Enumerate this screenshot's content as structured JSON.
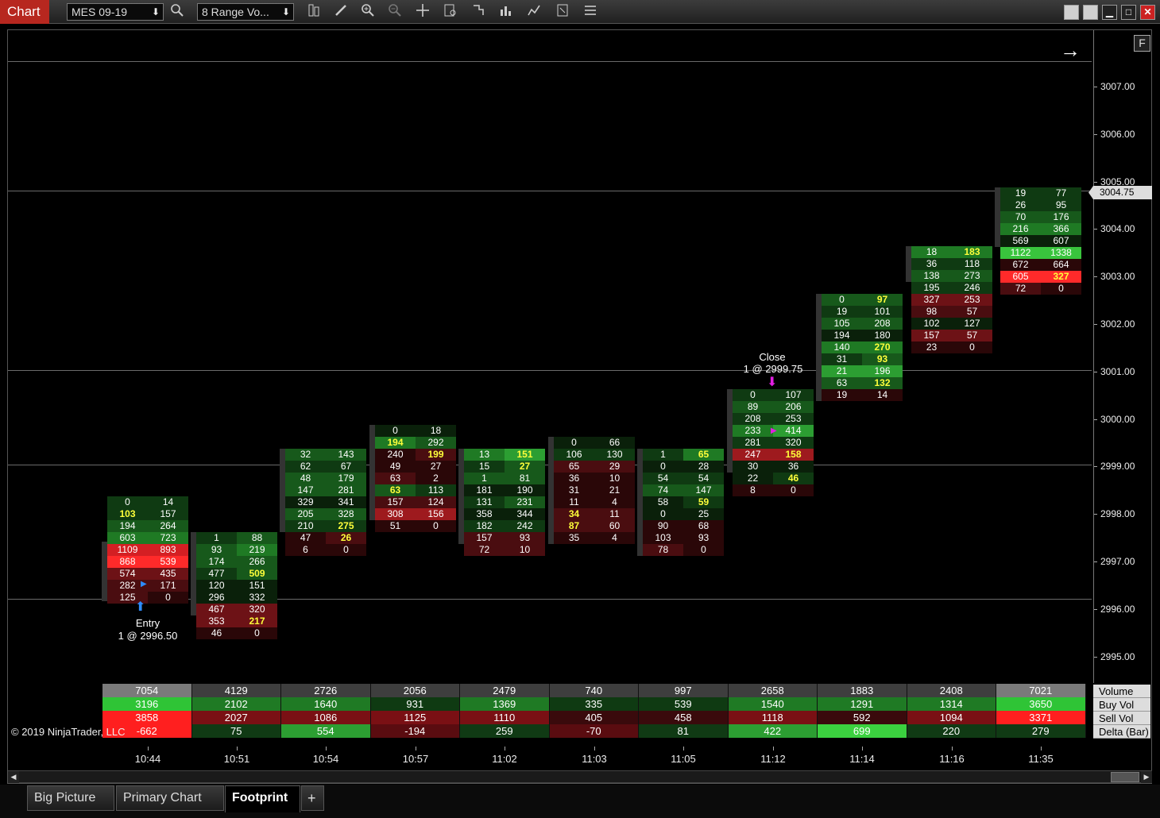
{
  "toolbar": {
    "title": "Chart",
    "instrument": "MES 09-19",
    "bar_type": "8 Range Vo..."
  },
  "window_buttons": [
    "▀",
    "▀",
    "▁",
    "□",
    "✕"
  ],
  "price_axis": {
    "labels": [
      "3007.00",
      "3006.00",
      "3005.00",
      "3004.00",
      "3003.00",
      "3002.00",
      "3001.00",
      "3000.00",
      "2999.00",
      "2998.00",
      "2997.00",
      "2996.00",
      "2995.00"
    ],
    "current_price": "3004.75",
    "f_button": "F"
  },
  "bars": [
    {
      "rows": [
        [
          "0",
          "14",
          "g2",
          "g2"
        ],
        [
          "103",
          "157",
          "g2",
          "g2"
        ],
        [
          "194",
          "264",
          "g3",
          "g3"
        ],
        [
          "603",
          "723",
          "g4",
          "g4"
        ],
        [
          "1109",
          "893",
          "r5",
          "r5"
        ],
        [
          "868",
          "539",
          "r6",
          "r6"
        ],
        [
          "574",
          "435",
          "r3",
          "r3"
        ],
        [
          "282",
          "171",
          "r2",
          "r2"
        ],
        [
          "125",
          "0",
          "r2",
          "r1"
        ]
      ],
      "hl": [
        [
          1,
          0
        ]
      ]
    },
    {
      "rows": [
        [
          "1",
          "88",
          "g2",
          "g3"
        ],
        [
          "93",
          "219",
          "g3",
          "g4"
        ],
        [
          "174",
          "266",
          "g3",
          "g3"
        ],
        [
          "477",
          "509",
          "g2",
          "g3"
        ],
        [
          "120",
          "151",
          "g1",
          "g1"
        ],
        [
          "296",
          "332",
          "g1",
          "g1"
        ],
        [
          "467",
          "320",
          "r3",
          "r3"
        ],
        [
          "353",
          "217",
          "r3",
          "r3"
        ],
        [
          "46",
          "0",
          "r1",
          "r1"
        ]
      ],
      "hl": [
        [
          3,
          1
        ],
        [
          7,
          1
        ]
      ]
    },
    {
      "rows": [
        [
          "32",
          "143",
          "g3",
          "g3"
        ],
        [
          "62",
          "67",
          "g2",
          "g2"
        ],
        [
          "48",
          "179",
          "g3",
          "g3"
        ],
        [
          "147",
          "281",
          "g3",
          "g3"
        ],
        [
          "329",
          "341",
          "g1",
          "g1"
        ],
        [
          "205",
          "328",
          "g3",
          "g3"
        ],
        [
          "210",
          "275",
          "g2",
          "g2"
        ],
        [
          "47",
          "26",
          "r1",
          "r2"
        ],
        [
          "6",
          "0",
          "r1",
          "r1"
        ]
      ],
      "hl": [
        [
          6,
          1
        ],
        [
          7,
          1
        ]
      ]
    },
    {
      "rows": [
        [
          "0",
          "18",
          "g1",
          "g1"
        ],
        [
          "194",
          "292",
          "g4",
          "g3"
        ],
        [
          "240",
          "199",
          "r1",
          "r2"
        ],
        [
          "49",
          "27",
          "r1",
          "r1"
        ],
        [
          "63",
          "2",
          "r2",
          "r1"
        ],
        [
          "63",
          "113",
          "g3",
          "g2"
        ],
        [
          "157",
          "124",
          "r2",
          "r2"
        ],
        [
          "308",
          "156",
          "r4",
          "r4"
        ],
        [
          "51",
          "0",
          "r1",
          "r1"
        ]
      ],
      "hl": [
        [
          1,
          0
        ],
        [
          2,
          1
        ],
        [
          5,
          0
        ]
      ]
    },
    {
      "rows": [
        [
          "13",
          "151",
          "g4",
          "g5"
        ],
        [
          "15",
          "27",
          "g2",
          "g3"
        ],
        [
          "1",
          "81",
          "g3",
          "g3"
        ],
        [
          "181",
          "190",
          "g1",
          "g1"
        ],
        [
          "131",
          "231",
          "g2",
          "g3"
        ],
        [
          "358",
          "344",
          "g1",
          "g1"
        ],
        [
          "182",
          "242",
          "g2",
          "g2"
        ],
        [
          "157",
          "93",
          "r2",
          "r2"
        ],
        [
          "72",
          "10",
          "r2",
          "r2"
        ]
      ],
      "hl": [
        [
          0,
          1
        ],
        [
          1,
          1
        ]
      ]
    },
    {
      "rows": [
        [
          "0",
          "66",
          "g1",
          "g1"
        ],
        [
          "106",
          "130",
          "g2",
          "g2"
        ],
        [
          "65",
          "29",
          "r2",
          "r2"
        ],
        [
          "36",
          "10",
          "r1",
          "r1"
        ],
        [
          "31",
          "21",
          "r1",
          "r1"
        ],
        [
          "11",
          "4",
          "r1",
          "r1"
        ],
        [
          "34",
          "11",
          "r2",
          "r2"
        ],
        [
          "87",
          "60",
          "r2",
          "r2"
        ],
        [
          "35",
          "4",
          "r1",
          "r1"
        ]
      ],
      "hl": [
        [
          6,
          0
        ],
        [
          7,
          0
        ]
      ]
    },
    {
      "rows": [
        [
          "1",
          "65",
          "g2",
          "g4"
        ],
        [
          "0",
          "28",
          "g1",
          "g1"
        ],
        [
          "54",
          "54",
          "g2",
          "g2"
        ],
        [
          "74",
          "147",
          "g3",
          "g3"
        ],
        [
          "58",
          "59",
          "g1",
          "g2"
        ],
        [
          "0",
          "25",
          "g1",
          "g1"
        ],
        [
          "90",
          "68",
          "r1",
          "r1"
        ],
        [
          "103",
          "93",
          "r1",
          "r1"
        ],
        [
          "78",
          "0",
          "r2",
          "r1"
        ]
      ],
      "hl": [
        [
          0,
          1
        ],
        [
          4,
          1
        ]
      ]
    },
    {
      "rows": [
        [
          "0",
          "107",
          "g2",
          "g2"
        ],
        [
          "89",
          "206",
          "g3",
          "g3"
        ],
        [
          "208",
          "253",
          "g2",
          "g2"
        ],
        [
          "233",
          "414",
          "g4",
          "g5"
        ],
        [
          "281",
          "320",
          "g2",
          "g2"
        ],
        [
          "247",
          "158",
          "r4",
          "r4"
        ],
        [
          "30",
          "36",
          "g1",
          "g1"
        ],
        [
          "22",
          "46",
          "g1",
          "g2"
        ],
        [
          "8",
          "0",
          "r1",
          "r1"
        ]
      ],
      "hl": [
        [
          5,
          1
        ],
        [
          7,
          1
        ]
      ]
    },
    {
      "rows": [
        [
          "0",
          "97",
          "g3",
          "g3"
        ],
        [
          "19",
          "101",
          "g2",
          "g2"
        ],
        [
          "105",
          "208",
          "g3",
          "g3"
        ],
        [
          "194",
          "180",
          "g1",
          "g1"
        ],
        [
          "140",
          "270",
          "g4",
          "g4"
        ],
        [
          "31",
          "93",
          "g2",
          "g3"
        ],
        [
          "21",
          "196",
          "g5",
          "g5"
        ],
        [
          "63",
          "132",
          "g3",
          "g3"
        ],
        [
          "19",
          "14",
          "r1",
          "r1"
        ]
      ],
      "hl": [
        [
          0,
          1
        ],
        [
          4,
          1
        ],
        [
          5,
          1
        ],
        [
          7,
          1
        ]
      ]
    },
    {
      "rows": [
        [
          "18",
          "183",
          "g4",
          "g4"
        ],
        [
          "36",
          "118",
          "g2",
          "g2"
        ],
        [
          "138",
          "273",
          "g3",
          "g3"
        ],
        [
          "195",
          "246",
          "g2",
          "g2"
        ],
        [
          "327",
          "253",
          "r3",
          "r3"
        ],
        [
          "98",
          "57",
          "r2",
          "r2"
        ],
        [
          "102",
          "127",
          "g1",
          "g1"
        ],
        [
          "157",
          "57",
          "r3",
          "r3"
        ],
        [
          "23",
          "0",
          "r1",
          "r1"
        ]
      ],
      "hl": [
        [
          0,
          1
        ]
      ]
    },
    {
      "rows": [
        [
          "19",
          "77",
          "g2",
          "g2"
        ],
        [
          "26",
          "95",
          "g2",
          "g2"
        ],
        [
          "70",
          "176",
          "g3",
          "g3"
        ],
        [
          "216",
          "366",
          "g4",
          "g4"
        ],
        [
          "569",
          "607",
          "g1",
          "g1"
        ],
        [
          "1122",
          "1338",
          "g6",
          "g6"
        ],
        [
          "672",
          "664",
          "r1",
          "r1"
        ],
        [
          "605",
          "327",
          "r6",
          "r6"
        ],
        [
          "72",
          "0",
          "r2",
          "r1"
        ]
      ],
      "hl": [
        [
          7,
          1
        ]
      ]
    }
  ],
  "markers": {
    "entry": {
      "label": "Entry",
      "detail": "1 @ 2996.50"
    },
    "close": {
      "label": "Close",
      "detail": "1 @ 2999.75"
    }
  },
  "summary": {
    "labels": [
      "Volume",
      "Buy Vol",
      "Sell Vol",
      "Delta (Bar)"
    ],
    "volume": [
      "7054",
      "4129",
      "2726",
      "2056",
      "2479",
      "740",
      "997",
      "2658",
      "1883",
      "2408",
      "7021"
    ],
    "buy_vol": [
      "3196",
      "2102",
      "1640",
      "931",
      "1369",
      "335",
      "539",
      "1540",
      "1291",
      "1314",
      "3650"
    ],
    "sell_vol": [
      "3858",
      "2027",
      "1086",
      "1125",
      "1110",
      "405",
      "458",
      "1118",
      "592",
      "1094",
      "3371"
    ],
    "delta": [
      "-662",
      "75",
      "554",
      "-194",
      "259",
      "-70",
      "81",
      "422",
      "699",
      "220",
      "279"
    ]
  },
  "time_axis": [
    "10:44",
    "10:51",
    "10:54",
    "10:57",
    "11:02",
    "11:03",
    "11:05",
    "11:12",
    "11:14",
    "11:16",
    "11:35"
  ],
  "copyright": "© 2019 NinjaTrader, LLC",
  "tabs": [
    {
      "label": "Big Picture"
    },
    {
      "label": "Primary Chart"
    },
    {
      "label": "Footprint"
    },
    {
      "label": "+"
    }
  ],
  "colors": {
    "g1": "#0a200a",
    "g2": "#0f3a12",
    "g3": "#17591b",
    "g4": "#1f7a24",
    "g5": "#2c9e32",
    "g6": "#39c43d",
    "r1": "#2a0708",
    "r2": "#4a0d10",
    "r3": "#6d1216",
    "r4": "#9e1a1e",
    "r5": "#d41f23",
    "r6": "#ff2a2a",
    "title_bg": "#b7271f",
    "highlight_text": "#ffff3a"
  }
}
